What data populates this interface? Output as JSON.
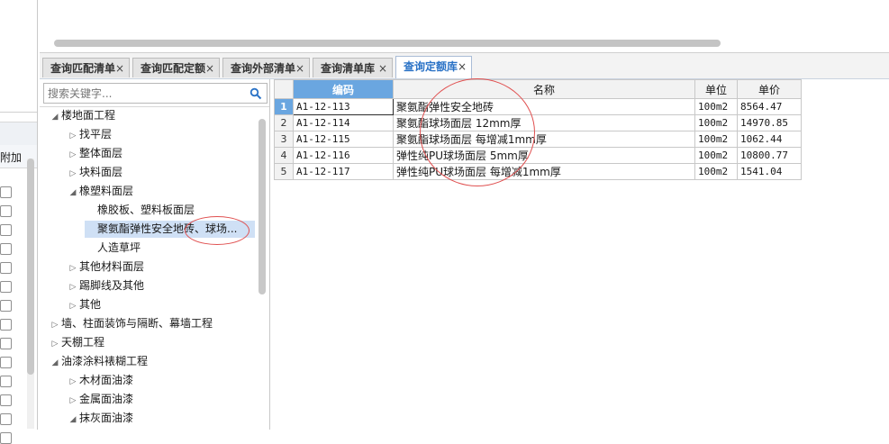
{
  "left_stub": {
    "header_label": "附加",
    "checkbox_count": 14
  },
  "tabs": [
    {
      "label": "查询匹配清单",
      "close": "×",
      "active": false
    },
    {
      "label": "查询匹配定额",
      "close": "×",
      "active": false
    },
    {
      "label": "查询外部清单",
      "close": "×",
      "active": false
    },
    {
      "label": "查询清单库",
      "close": "×",
      "active": false
    },
    {
      "label": "查询定额库",
      "close": "×",
      "active": true
    }
  ],
  "search": {
    "placeholder": "搜索关键字...",
    "icon": "search-icon"
  },
  "tree": [
    {
      "label": "楼地面工程",
      "level": 0,
      "state": "expanded"
    },
    {
      "label": "找平层",
      "level": 1,
      "state": "collapsed"
    },
    {
      "label": "整体面层",
      "level": 1,
      "state": "collapsed"
    },
    {
      "label": "块料面层",
      "level": 1,
      "state": "collapsed"
    },
    {
      "label": "橡塑料面层",
      "level": 1,
      "state": "expanded"
    },
    {
      "label": "橡胶板、塑料板面层",
      "level": 2,
      "state": "leaf"
    },
    {
      "label": "聚氨酯弹性安全地砖、球场...",
      "level": 2,
      "state": "leaf",
      "selected": true
    },
    {
      "label": "人造草坪",
      "level": 2,
      "state": "leaf"
    },
    {
      "label": "其他材料面层",
      "level": 1,
      "state": "collapsed"
    },
    {
      "label": "踢脚线及其他",
      "level": 1,
      "state": "collapsed"
    },
    {
      "label": "其他",
      "level": 1,
      "state": "collapsed"
    },
    {
      "label": "墙、柱面装饰与隔断、幕墙工程",
      "level": 0,
      "state": "collapsed"
    },
    {
      "label": "天棚工程",
      "level": 0,
      "state": "collapsed"
    },
    {
      "label": "油漆涂料裱糊工程",
      "level": 0,
      "state": "expanded"
    },
    {
      "label": "木材面油漆",
      "level": 1,
      "state": "collapsed"
    },
    {
      "label": "金属面油漆",
      "level": 1,
      "state": "collapsed"
    },
    {
      "label": "抹灰面油漆",
      "level": 1,
      "state": "expanded"
    }
  ],
  "grid": {
    "columns": [
      "编码",
      "名称",
      "单位",
      "单价"
    ],
    "rows": [
      {
        "num": "1",
        "code": "A1-12-113",
        "name": "聚氨酯弹性安全地砖",
        "unit": "100m2",
        "price": "8564.47"
      },
      {
        "num": "2",
        "code": "A1-12-114",
        "name": "聚氨酯球场面层 12mm厚",
        "unit": "100m2",
        "price": "14970.85"
      },
      {
        "num": "3",
        "code": "A1-12-115",
        "name": "聚氨酯球场面层 每增减1mm厚",
        "unit": "100m2",
        "price": "1062.44"
      },
      {
        "num": "4",
        "code": "A1-12-116",
        "name": "弹性纯PU球场面层 5mm厚",
        "unit": "100m2",
        "price": "10800.77"
      },
      {
        "num": "5",
        "code": "A1-12-117",
        "name": "弹性纯PU球场面层 每增减1mm厚",
        "unit": "100m2",
        "price": "1541.04"
      }
    ]
  },
  "colors": {
    "accent": "#2a72c6",
    "selected_header": "#6aa6e0",
    "annotation": "#e05050"
  }
}
